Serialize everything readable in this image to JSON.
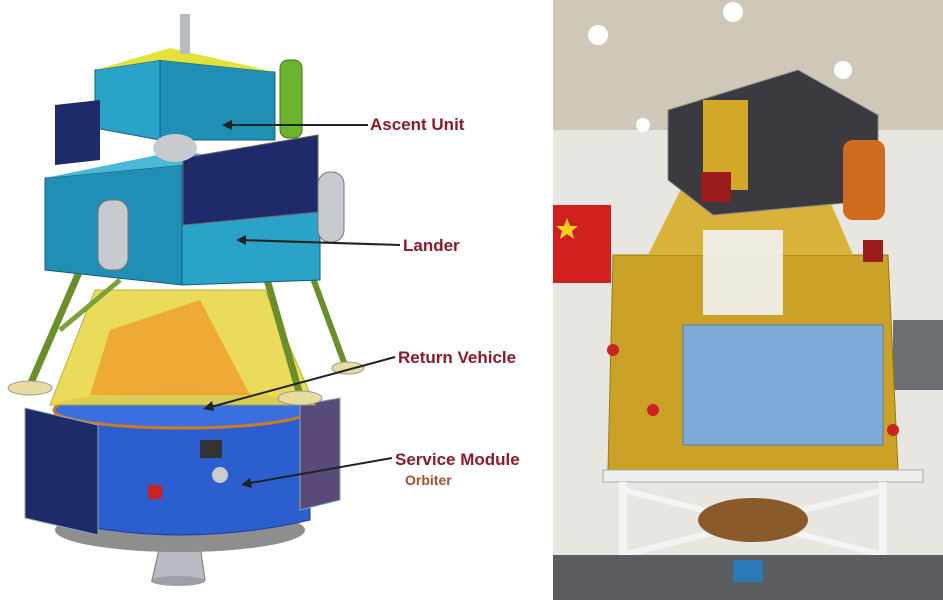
{
  "diagram": {
    "labels": {
      "ascent_unit": "Ascent Unit",
      "lander": "Lander",
      "return_vehicle": "Return Vehicle",
      "service_module": "Service Module",
      "orbiter": "Orbiter"
    },
    "colors": {
      "label_main": "#8b1a2b",
      "label_sub": "#a0522d",
      "ascent_body": "#2aa3c9",
      "lander_body": "#1f8fb5",
      "solar_panel": "#1f2a6b",
      "return_vehicle": "#e8d84a",
      "service_module": "#2b5fd0",
      "orbiter_engine": "#9aa0a6",
      "green_tank": "#6ab42e"
    }
  },
  "photo": {
    "colors": {
      "wall": "#e8e6e1",
      "gold_foil": "#c9a227",
      "blue_cover": "#7fa9d6",
      "dark_top": "#3a3a40",
      "flag_red": "#d21f1f",
      "flag_star": "#f7d21e",
      "stand": "#eeeeee"
    }
  }
}
